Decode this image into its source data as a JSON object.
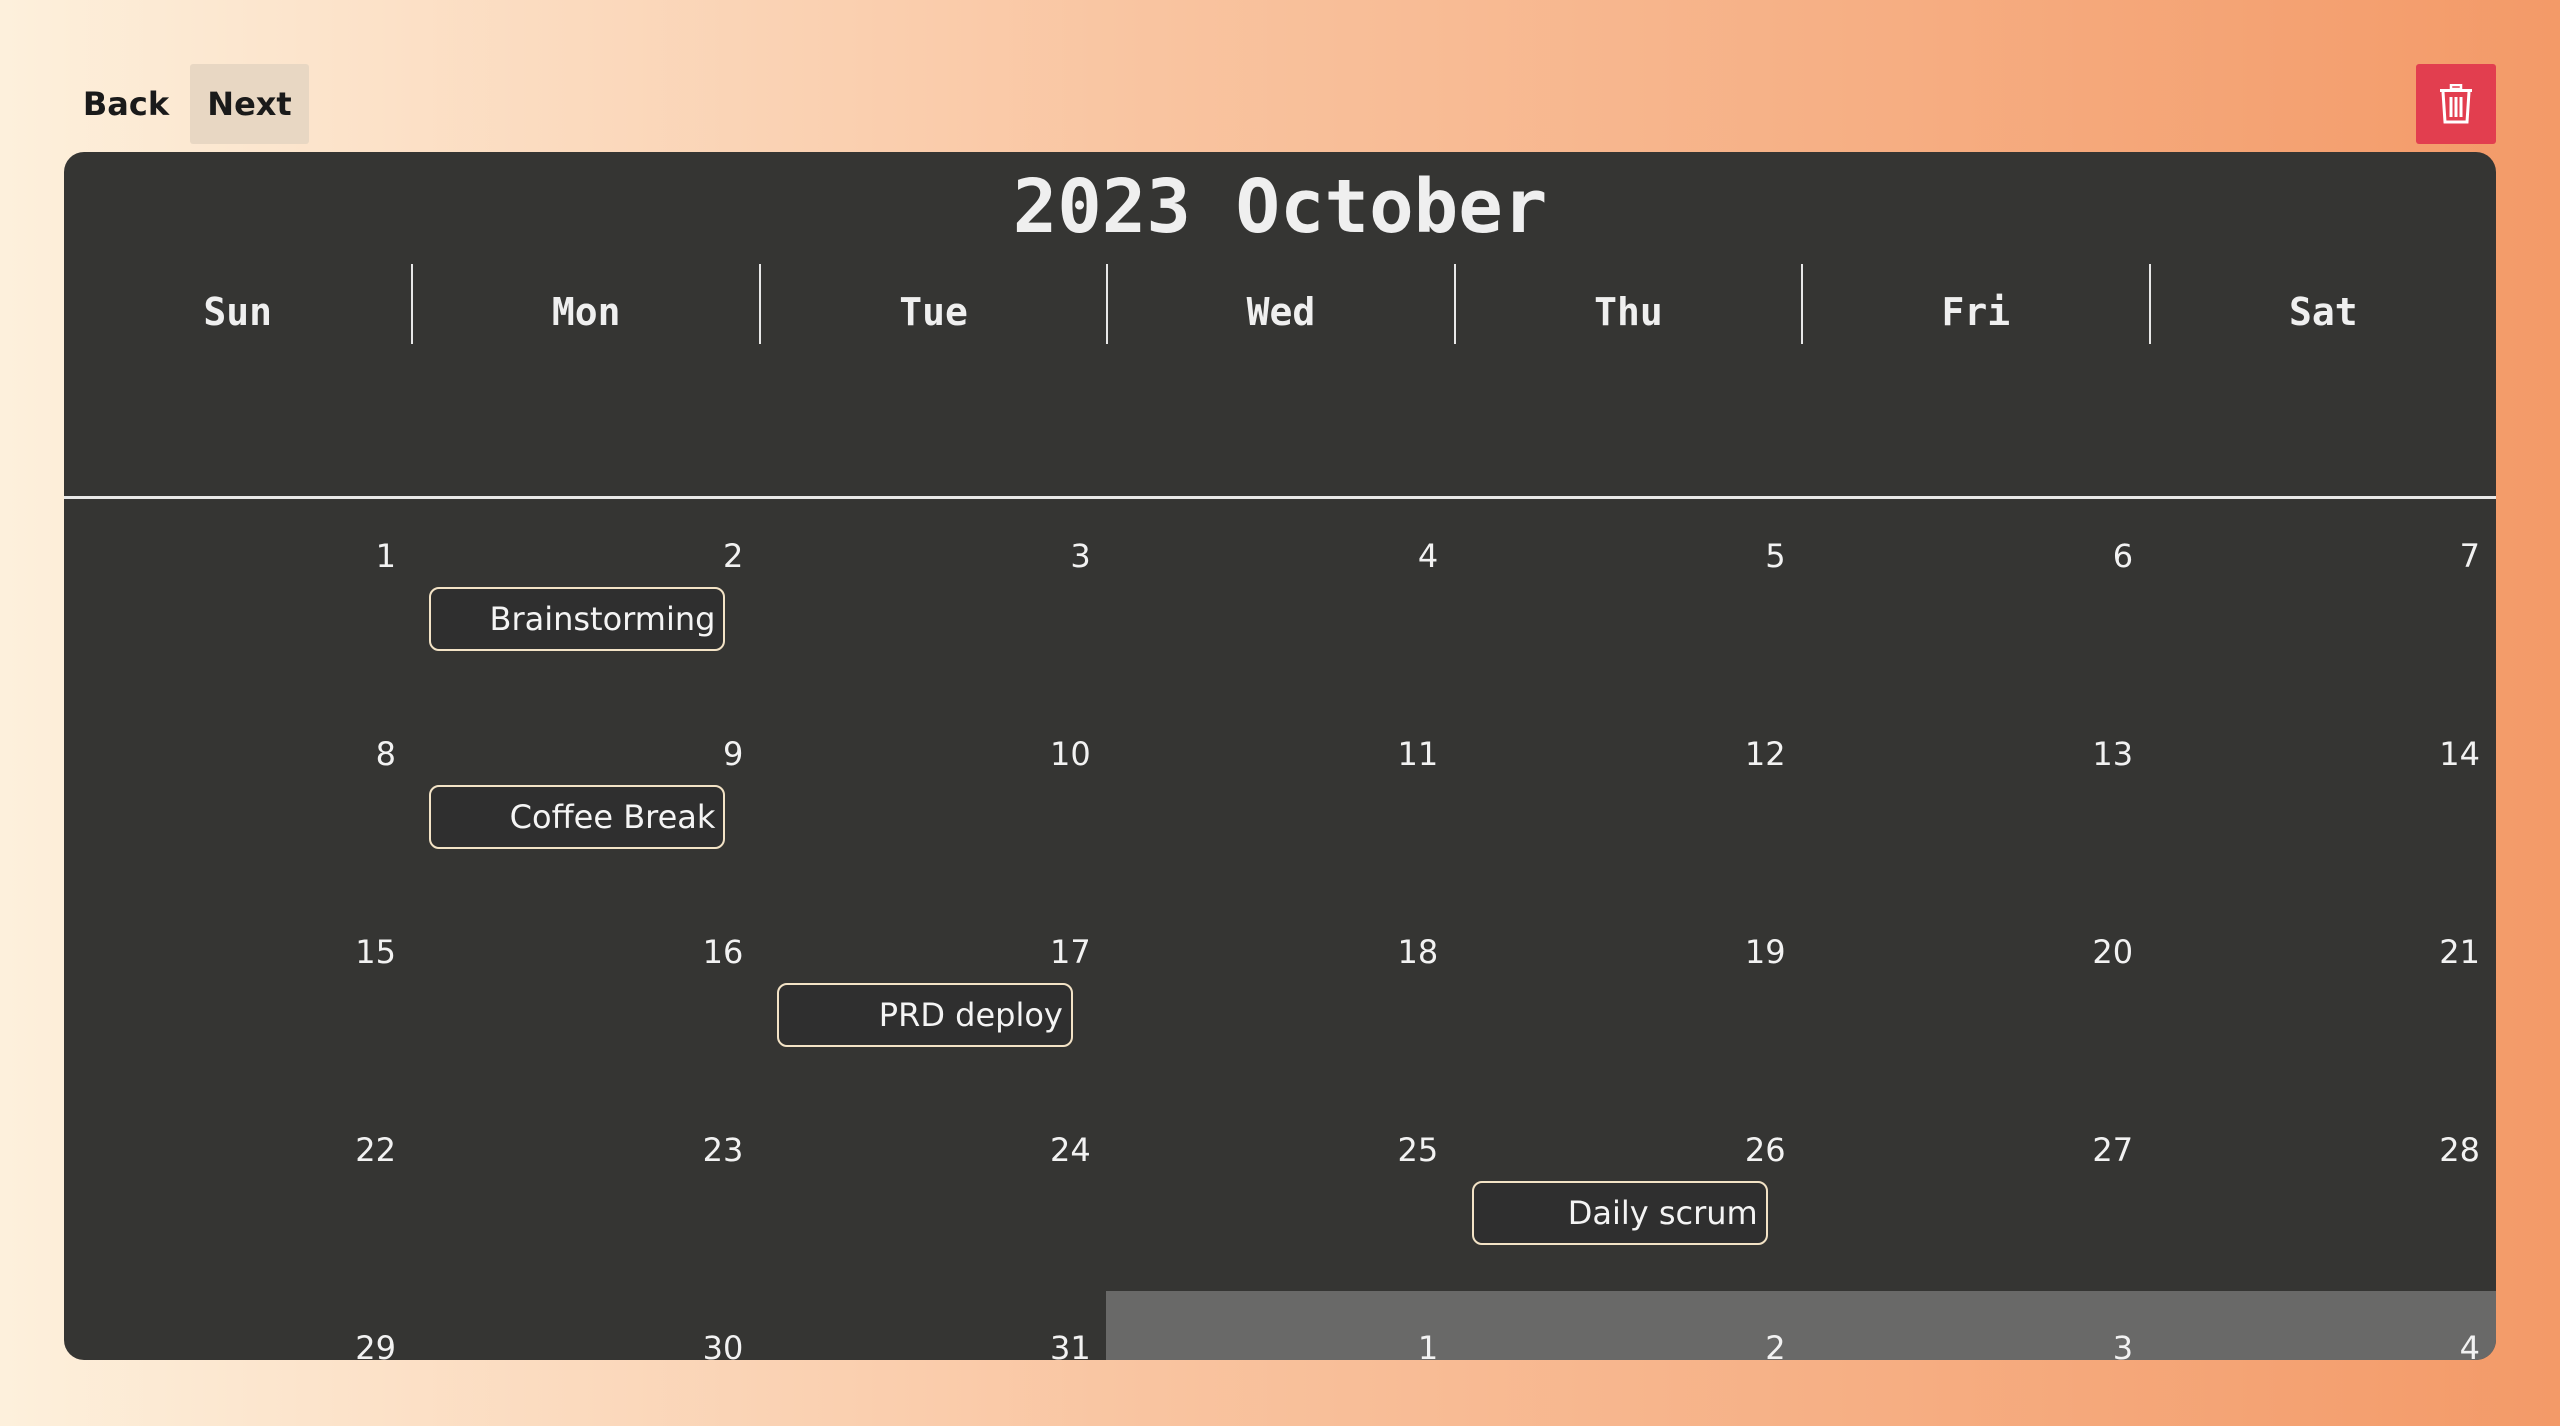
{
  "toolbar": {
    "back_label": "Back",
    "next_label": "Next",
    "delete_icon": "trash-icon"
  },
  "calendar": {
    "title": "2023 October",
    "weekdays": [
      "Sun",
      "Mon",
      "Tue",
      "Wed",
      "Thu",
      "Fri",
      "Sat"
    ],
    "weeks": [
      [
        {
          "day": "1"
        },
        {
          "day": "2",
          "event": "Brainstorming"
        },
        {
          "day": "3"
        },
        {
          "day": "4"
        },
        {
          "day": "5"
        },
        {
          "day": "6"
        },
        {
          "day": "7"
        }
      ],
      [
        {
          "day": "8"
        },
        {
          "day": "9",
          "event": "Coffee Break"
        },
        {
          "day": "10"
        },
        {
          "day": "11"
        },
        {
          "day": "12"
        },
        {
          "day": "13"
        },
        {
          "day": "14"
        }
      ],
      [
        {
          "day": "15"
        },
        {
          "day": "16"
        },
        {
          "day": "17",
          "event": "PRD deploy"
        },
        {
          "day": "18"
        },
        {
          "day": "19"
        },
        {
          "day": "20"
        },
        {
          "day": "21"
        }
      ],
      [
        {
          "day": "22"
        },
        {
          "day": "23"
        },
        {
          "day": "24"
        },
        {
          "day": "25"
        },
        {
          "day": "26",
          "event": "Daily scrum"
        },
        {
          "day": "27"
        },
        {
          "day": "28"
        }
      ],
      [
        {
          "day": "29"
        },
        {
          "day": "30"
        },
        {
          "day": "31"
        },
        {
          "day": "1",
          "next_month": true
        },
        {
          "day": "2",
          "next_month": true
        },
        {
          "day": "3",
          "next_month": true
        },
        {
          "day": "4",
          "next_month": true
        }
      ]
    ]
  },
  "colors": {
    "calendar_bg": "#353533",
    "next_month_bg": "#696968",
    "delete_bg": "#e23e4f",
    "event_border": "#f3e3c6"
  }
}
